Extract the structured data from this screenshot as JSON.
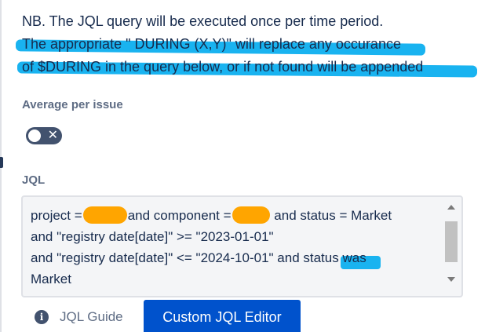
{
  "note": {
    "line1": "NB. The JQL query will be executed once per time period.",
    "line2": "The appropriate \" DURING (X,Y)\" will replace any occurance",
    "line3": "of $DURING in the query below, or if not found will be appended"
  },
  "average_per_issue": {
    "label": "Average per issue",
    "toggle_state": "off",
    "toggle_symbol": "✕"
  },
  "jql": {
    "label": "JQL",
    "line1_part1": "project =",
    "line1_part2": "and component =",
    "line1_part3": "and status = Market",
    "line2": "and \"registry date[date]\" >= \"2023-01-01\"",
    "line3_part1": "and \"registry date[date]\" <= \"2024-10-01\" and status",
    "line3_part2": "was",
    "line4": "Market"
  },
  "footer": {
    "guide_label": "JQL Guide",
    "info_icon_glyph": "i",
    "custom_editor_label": "Custom JQL Editor"
  },
  "colors": {
    "highlight_blue": "#19b3f0",
    "redaction_orange": "#ffa500",
    "primary_button": "#0052cc"
  }
}
